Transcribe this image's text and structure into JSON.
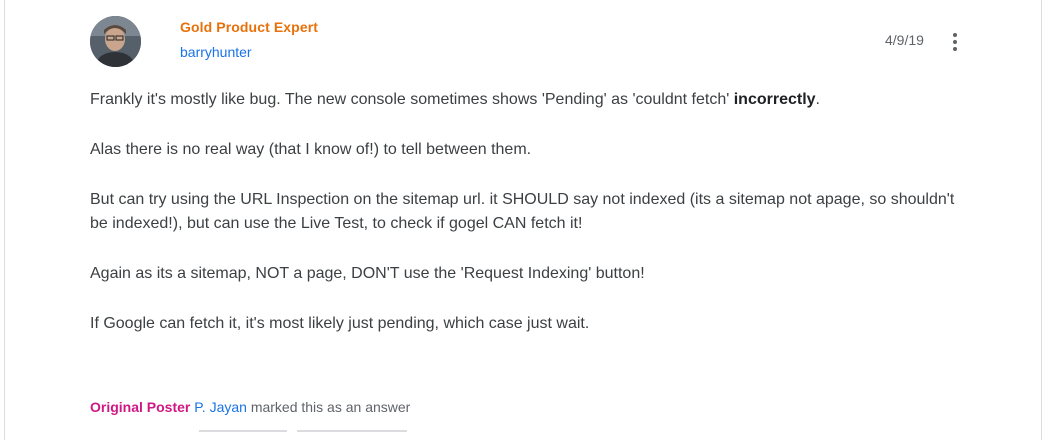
{
  "author": {
    "badge": "Gold Product Expert",
    "username": "barryhunter",
    "date": "4/9/19"
  },
  "icons": {
    "avatar": "avatar-photo",
    "more": "more-vert-icon"
  },
  "post": {
    "p1_a": "Frankly it's mostly like  bug. The new console sometimes shows 'Pending' as 'couldnt fetch' ",
    "p1_bold": "incorrectly",
    "p1_b": ".",
    "p2": "Alas there is no real way (that I know of!) to tell between them.",
    "p3": "But can try using the URL Inspection on the sitemap url. it SHOULD say not indexed (its a sitemap not apage, so shouldn't be indexed!), but can use the Live Test, to check if gogel CAN fetch it!",
    "p4": "Again as its a sitemap, NOT a page, DON'T use the 'Request Indexing' button!",
    "p5": "If Google can fetch it, it's most likely just pending, which case just wait."
  },
  "footer": {
    "original_poster": "Original Poster",
    "poster_name": "P. Jayan",
    "marked_text": "marked this as an answer"
  },
  "colors": {
    "badge": "#e8710a",
    "link": "#1a73e8",
    "original_poster": "#d01884"
  }
}
